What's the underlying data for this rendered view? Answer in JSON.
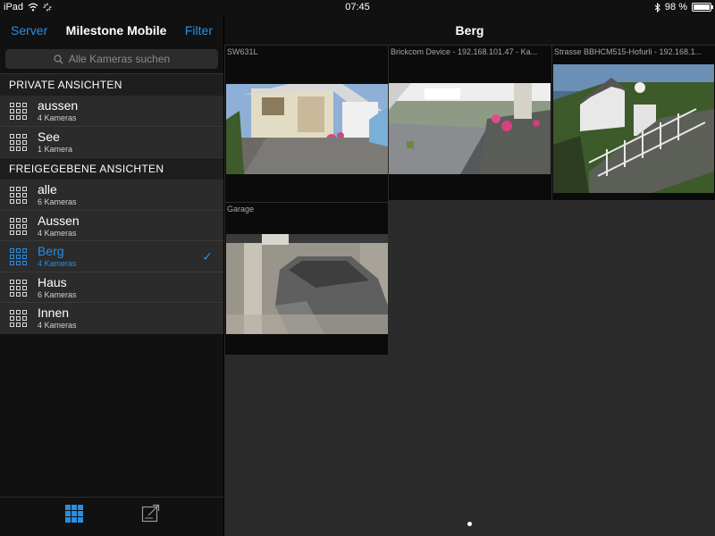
{
  "statusbar": {
    "device": "iPad",
    "time": "07:45",
    "battery_text": "98 %",
    "battery_level": 0.98
  },
  "sidebar": {
    "server_label": "Server",
    "title": "Milestone Mobile",
    "filter_label": "Filter",
    "search_placeholder": "Alle Kameras suchen",
    "private_header": "PRIVATE ANSICHTEN",
    "private_items": [
      {
        "name": "aussen",
        "count": "4 Kameras"
      },
      {
        "name": "See",
        "count": "1 Kamera"
      }
    ],
    "shared_header": "FREIGEGEBENE ANSICHTEN",
    "shared_items": [
      {
        "name": "alle",
        "count": "6 Kameras"
      },
      {
        "name": "Aussen",
        "count": "4 Kameras"
      },
      {
        "name": "Berg",
        "count": "4 Kameras",
        "selected": true
      },
      {
        "name": "Haus",
        "count": "6 Kameras"
      },
      {
        "name": "Innen",
        "count": "4 Kameras"
      }
    ]
  },
  "main": {
    "title": "Berg",
    "tiles": [
      {
        "caption": "SW631L"
      },
      {
        "caption": "Brickcom Device - 192.168.101.47 - Ka..."
      },
      {
        "caption": "Strasse BBHCM515-Hofurli - 192.168.1..."
      },
      {
        "caption": "Garage"
      }
    ]
  },
  "colors": {
    "accent": "#2a8ee0",
    "background": "#111111",
    "panel": "#2b2b2b"
  },
  "icons": [
    "wifi-icon",
    "activity-icon",
    "bluetooth-icon",
    "battery-icon",
    "search-icon",
    "grid-view-icon",
    "checkmark-icon",
    "export-icon"
  ]
}
